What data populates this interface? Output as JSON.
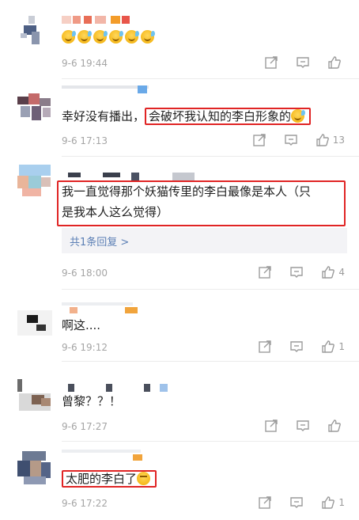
{
  "comments": [
    {
      "text": "",
      "emoji_count": 6,
      "emoji_icon": "laugh-sweat-emoji",
      "timestamp": "9-6 19:44",
      "likes": ""
    },
    {
      "text_plain": "幸好没有播出，",
      "text_highlight": "会破坏我认知的李白形象的",
      "emoji_icon": "laugh-sweat-emoji",
      "timestamp": "9-6 17:13",
      "likes": "13"
    },
    {
      "line1": "我一直觉得那个妖猫传里的李白最像是本人（只",
      "line2": "是我本人这么觉得）",
      "reply_label": "共1条回复 >",
      "timestamp": "9-6 18:00",
      "likes": "4"
    },
    {
      "text": "啊这....",
      "timestamp": "9-6 19:12",
      "likes": "1"
    },
    {
      "text": "曾黎？？！",
      "timestamp": "9-6 17:27",
      "likes": ""
    },
    {
      "text": "太肥的李白了",
      "emoji_icon": "thinking-emoji",
      "timestamp": "9-6 17:22",
      "likes": "1"
    }
  ],
  "icons": {
    "repost": "share-icon",
    "comment": "comment-icon",
    "like": "thumbs-up-icon"
  },
  "colors": {
    "highlight_border": "#e02424",
    "reply_link": "#5b7fb5",
    "timestamp": "#a5a5a5"
  }
}
